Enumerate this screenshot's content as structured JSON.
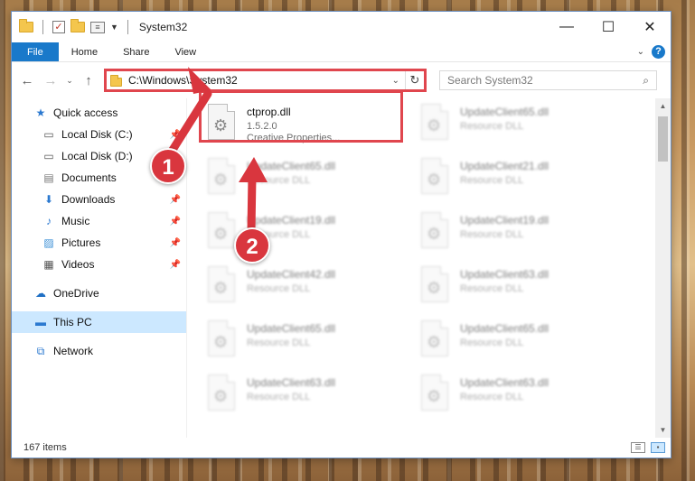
{
  "window": {
    "title": "System32"
  },
  "ribbon": {
    "tabs": [
      "File",
      "Home",
      "Share",
      "View"
    ]
  },
  "nav": {
    "address": "C:\\Windows\\System32",
    "search_placeholder": "Search System32"
  },
  "sidebar": {
    "items": [
      {
        "label": "Quick access",
        "icon": "star-icon",
        "level": 0,
        "pinned": false
      },
      {
        "label": "Local Disk (C:)",
        "icon": "drive-icon",
        "level": 1,
        "pinned": true
      },
      {
        "label": "Local Disk (D:)",
        "icon": "drive-icon",
        "level": 1,
        "pinned": true
      },
      {
        "label": "Documents",
        "icon": "documents-icon",
        "level": 1,
        "pinned": true
      },
      {
        "label": "Downloads",
        "icon": "download-icon",
        "level": 1,
        "pinned": true
      },
      {
        "label": "Music",
        "icon": "music-icon",
        "level": 1,
        "pinned": true
      },
      {
        "label": "Pictures",
        "icon": "pictures-icon",
        "level": 1,
        "pinned": true
      },
      {
        "label": "Videos",
        "icon": "videos-icon",
        "level": 1,
        "pinned": true
      },
      {
        "label": "OneDrive",
        "icon": "cloud-icon",
        "level": 0,
        "pinned": false
      },
      {
        "label": "This PC",
        "icon": "computer-icon",
        "level": 0,
        "pinned": false,
        "selected": true
      },
      {
        "label": "Network",
        "icon": "network-icon",
        "level": 0,
        "pinned": false
      }
    ]
  },
  "files": [
    {
      "name": "ctprop.dll",
      "line2": "1.5.2.0",
      "line3": "Creative Properties...",
      "highlighted": true
    },
    {
      "name": "UpdateClient65.dll",
      "line2": "Resource DLL"
    },
    {
      "name": "UpdateClient65.dll",
      "line2": "Resource DLL"
    },
    {
      "name": "UpdateClient21.dll",
      "line2": "Resource DLL"
    },
    {
      "name": "UpdateClient19.dll",
      "line2": "Resource DLL"
    },
    {
      "name": "UpdateClient19.dll",
      "line2": "Resource DLL"
    },
    {
      "name": "UpdateClient42.dll",
      "line2": "Resource DLL"
    },
    {
      "name": "UpdateClient63.dll",
      "line2": "Resource DLL"
    },
    {
      "name": "UpdateClient65.dll",
      "line2": "Resource DLL"
    },
    {
      "name": "UpdateClient65.dll",
      "line2": "Resource DLL"
    },
    {
      "name": "UpdateClient63.dll",
      "line2": "Resource DLL"
    },
    {
      "name": "UpdateClient63.dll",
      "line2": "Resource DLL"
    }
  ],
  "status": {
    "item_count": "167 items"
  },
  "annotations": {
    "step1": "1",
    "step2": "2",
    "color": "#d9363e"
  }
}
